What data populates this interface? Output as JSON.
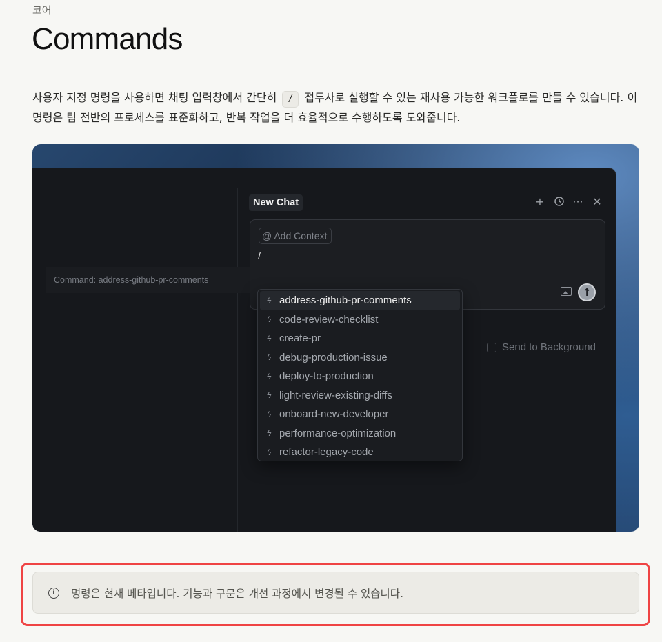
{
  "breadcrumb": "코어",
  "title": "Commands",
  "intro": {
    "before": "사용자 지정 명령을 사용하면 채팅 입력창에서 간단히",
    "code": "/",
    "after": "접두사로 실행할 수 있는 재사용 가능한 워크플로를 만들 수 있습니다. 이 명령은 팀 전반의 프로세스를 표준화하고, 반복 작업을 더 효율적으로 수행하도록 도와줍니다."
  },
  "app": {
    "tooltip": "Command: address-github-pr-comments",
    "chat_tab": "New Chat",
    "toolbar_icons": [
      "plus-icon",
      "history-icon",
      "more-icon",
      "close-icon"
    ],
    "context_chip": "@ Add Context",
    "input_value": "/",
    "send_to_background": "Send to Background",
    "commands": [
      "address-github-pr-comments",
      "code-review-checklist",
      "create-pr",
      "debug-production-issue",
      "deploy-to-production",
      "light-review-existing-diffs",
      "onboard-new-developer",
      "performance-optimization",
      "refactor-legacy-code"
    ]
  },
  "callout": {
    "text": "명령은 현재 베타입니다. 기능과 구문은 개선 과정에서 변경될 수 있습니다.",
    "icon": "info-icon"
  },
  "colors": {
    "page_bg": "#f7f7f4",
    "highlight": "#ef4444",
    "app_bg": "#16181c"
  }
}
